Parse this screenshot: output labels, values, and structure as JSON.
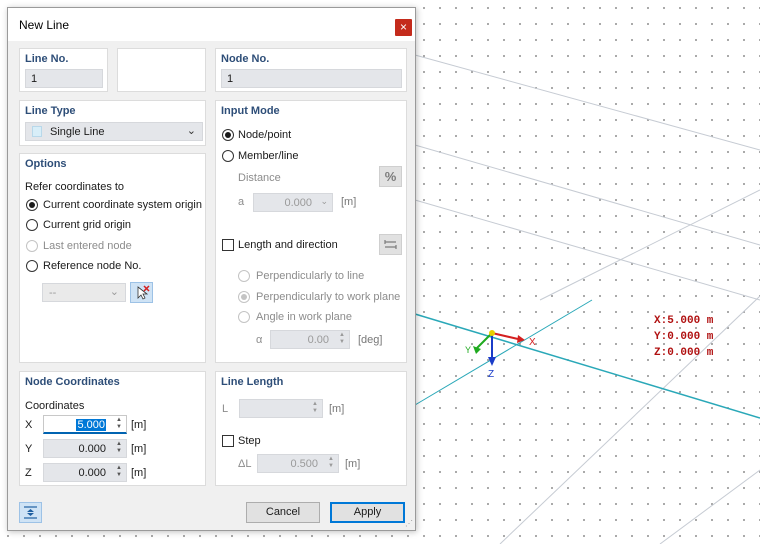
{
  "dialog": {
    "title": "New Line",
    "close_glyph": "×",
    "line_no": {
      "label": "Line No.",
      "value": "1"
    },
    "node_no": {
      "label": "Node No.",
      "value": "1"
    },
    "line_type": {
      "label": "Line Type",
      "value": "Single Line"
    },
    "input_mode": {
      "label": "Input Mode",
      "node_point": "Node/point",
      "member_line": "Member/line",
      "distance_label": "Distance",
      "a_label": "a",
      "a_value": "0.000",
      "a_unit": "[m]",
      "percent_glyph": "%",
      "length_direction": "Length and direction",
      "perp_line": "Perpendicularly to line",
      "perp_plane": "Perpendicularly to work plane",
      "angle_plane": "Angle in work plane",
      "alpha_label": "α",
      "alpha_value": "0.00",
      "alpha_unit": "[deg]"
    },
    "options": {
      "label": "Options",
      "refer_label": "Refer coordinates to",
      "opt_cs_origin": "Current coordinate system origin",
      "opt_grid_origin": "Current grid origin",
      "opt_last_node": "Last entered node",
      "opt_ref_node": "Reference node No.",
      "ref_node_value": "--"
    },
    "node_coordinates": {
      "label": "Node Coordinates",
      "coords_label": "Coordinates",
      "x_label": "X",
      "x_value": "5.000",
      "y_label": "Y",
      "y_value": "0.000",
      "z_label": "Z",
      "z_value": "0.000",
      "unit": "[m]"
    },
    "line_length": {
      "label": "Line Length",
      "l_label": "L",
      "l_unit": "[m]",
      "step_label": "Step",
      "dl_label": "ΔL",
      "dl_value": "0.500",
      "dl_unit": "[m]"
    },
    "buttons": {
      "cancel": "Cancel",
      "apply": "Apply"
    }
  },
  "viewport": {
    "coord_x": "X:5.000 m",
    "coord_y": "Y:0.000 m",
    "coord_z": "Z:0.000 m",
    "axis_x": "X",
    "axis_y": "Y",
    "axis_z": "Z",
    "colors": {
      "axis_x": "#d42020",
      "axis_y": "#1faa1f",
      "axis_z": "#1a3cc8",
      "line": "#2aa8b8",
      "readout": "#b01010"
    }
  }
}
